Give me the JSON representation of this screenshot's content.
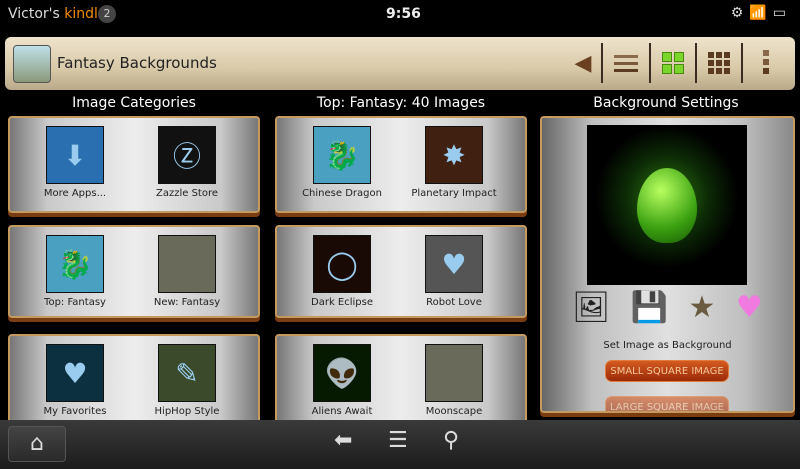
{
  "status": {
    "owner": "Victor's",
    "brand": "kindle",
    "notifications": "2",
    "time": "9:56"
  },
  "header": {
    "title": "Fantasy Backgrounds"
  },
  "columns": {
    "categories": "Image Categories",
    "images": "Top: Fantasy: 40 Images",
    "settings": "Background Settings"
  },
  "categories": [
    [
      {
        "label": "More Apps...",
        "icon": "⬇",
        "bg": "#2a6fb0"
      },
      {
        "label": "Zazzle Store",
        "icon": "Ⓩ",
        "bg": "#111"
      }
    ],
    [
      {
        "label": "Top: Fantasy",
        "icon": "🐉",
        "bg": "#4aa0c0"
      },
      {
        "label": "New: Fantasy",
        "icon": "",
        "bg": "#6a6a5a"
      }
    ],
    [
      {
        "label": "My Favorites",
        "icon": "♥",
        "bg": "#0c3040"
      },
      {
        "label": "HipHop Style",
        "icon": "✎",
        "bg": "#3a4a2a"
      }
    ]
  ],
  "images": [
    [
      {
        "label": "Chinese Dragon",
        "icon": "🐉",
        "bg": "#4aa0c0"
      },
      {
        "label": "Planetary Impact",
        "icon": "✸",
        "bg": "#402010"
      }
    ],
    [
      {
        "label": "Dark Eclipse",
        "icon": "◯",
        "bg": "#1a0a05"
      },
      {
        "label": "Robot Love",
        "icon": "♥",
        "bg": "#555"
      }
    ],
    [
      {
        "label": "Aliens Await",
        "icon": "👽",
        "bg": "#061a02"
      },
      {
        "label": "Moonscape",
        "icon": "",
        "bg": "#6a6a5a"
      }
    ]
  ],
  "settings": {
    "set_label": "Set Image as Background",
    "small_button": "SMALL SQUARE IMAGE",
    "large_button": "LARGE SQUARE IMAGE"
  }
}
